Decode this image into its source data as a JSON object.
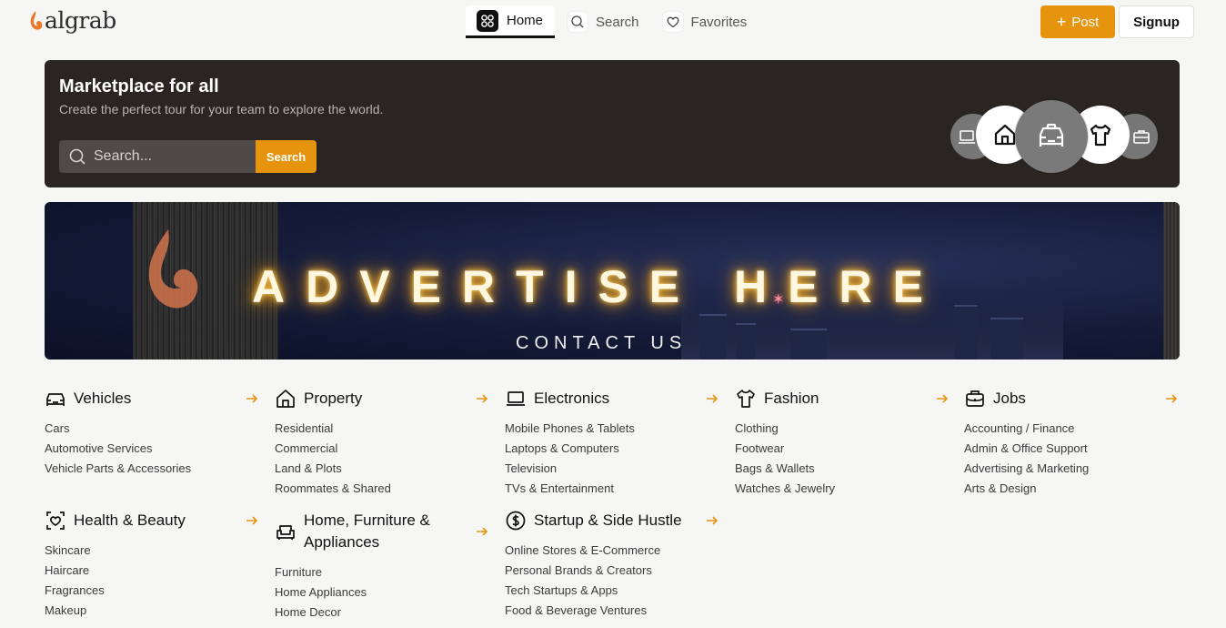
{
  "brand": {
    "name": "algrab",
    "accent": "#e6940e"
  },
  "nav": {
    "home": "Home",
    "search": "Search",
    "favorites": "Favorites"
  },
  "actions": {
    "post": "Post",
    "signup": "Signup"
  },
  "hero": {
    "title": "Marketplace for all",
    "subtitle": "Create the perfect tour for your team to explore the world.",
    "search_placeholder": "Search...",
    "search_button": "Search",
    "carousel_icons": [
      "laptop-icon",
      "house-icon",
      "car-icon",
      "shirt-icon",
      "briefcase-icon"
    ]
  },
  "banner": {
    "headline": "ADVERTISE HERE",
    "cta": "CONTACT US"
  },
  "categories": [
    {
      "title": "Vehicles",
      "icon": "car-icon",
      "items": [
        "Cars",
        "Automotive Services",
        "Vehicle Parts & Accessories"
      ]
    },
    {
      "title": "Property",
      "icon": "house-icon",
      "items": [
        "Residential",
        "Commercial",
        "Land & Plots",
        "Roommates & Shared"
      ]
    },
    {
      "title": "Electronics",
      "icon": "laptop-icon",
      "items": [
        "Mobile Phones & Tablets",
        "Laptops & Computers",
        "Television",
        "TVs & Entertainment"
      ]
    },
    {
      "title": "Fashion",
      "icon": "shirt-icon",
      "items": [
        "Clothing",
        "Footwear",
        "Bags & Wallets",
        "Watches & Jewelry"
      ]
    },
    {
      "title": "Jobs",
      "icon": "briefcase-icon",
      "items": [
        "Accounting / Finance",
        "Admin & Office Support",
        "Advertising & Marketing",
        "Arts & Design"
      ]
    },
    {
      "title": "Health & Beauty",
      "icon": "heart-icon",
      "items": [
        "Skincare",
        "Haircare",
        "Fragrances",
        "Makeup"
      ]
    },
    {
      "title": "Home, Furniture & Appliances",
      "icon": "sofa-icon",
      "items": [
        "Furniture",
        "Home Appliances",
        "Home Decor"
      ]
    },
    {
      "title": "Startup & Side Hustle",
      "icon": "dollar-icon",
      "items": [
        "Online Stores & E-Commerce",
        "Personal Brands & Creators",
        "Tech Startups & Apps",
        "Food & Beverage Ventures"
      ]
    }
  ]
}
